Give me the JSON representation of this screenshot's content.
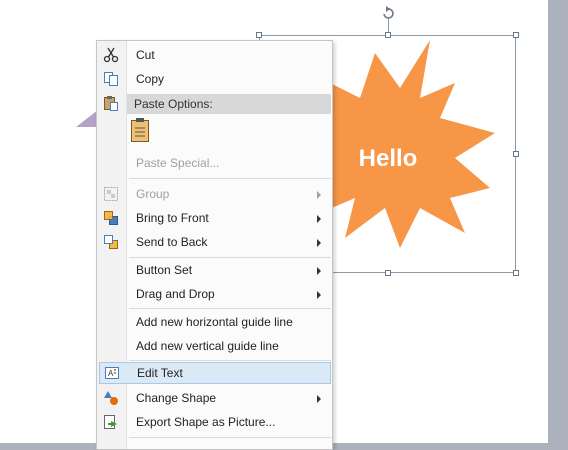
{
  "canvas": {
    "shape_text": "Hello",
    "colors": {
      "star_fill": "#f79646",
      "triangle_fill": "#b3a2c7",
      "page": "#ffffff",
      "workspace": "#abb2bd"
    }
  },
  "menu": {
    "items": {
      "cut": {
        "label": "Cut",
        "icon": "scissors-icon"
      },
      "copy": {
        "label": "Copy",
        "icon": "copy-icon"
      },
      "paste_options": {
        "label": "Paste Options:",
        "icon": "paste-icon"
      },
      "paste_special": {
        "label": "Paste Special..."
      },
      "group": {
        "label": "Group",
        "icon": "group-icon"
      },
      "bring_to_front": {
        "label": "Bring to Front",
        "icon": "bring-to-front-icon"
      },
      "send_to_back": {
        "label": "Send to Back",
        "icon": "send-to-back-icon"
      },
      "button_set": {
        "label": "Button Set"
      },
      "drag_and_drop": {
        "label": "Drag and Drop"
      },
      "add_h_guide": {
        "label": "Add new horizontal guide line"
      },
      "add_v_guide": {
        "label": "Add new vertical guide line"
      },
      "edit_text": {
        "label": "Edit Text",
        "icon": "edit-text-icon"
      },
      "change_shape": {
        "label": "Change Shape",
        "icon": "change-shape-icon"
      },
      "export_shape": {
        "label": "Export Shape as Picture...",
        "icon": "export-picture-icon"
      }
    }
  }
}
